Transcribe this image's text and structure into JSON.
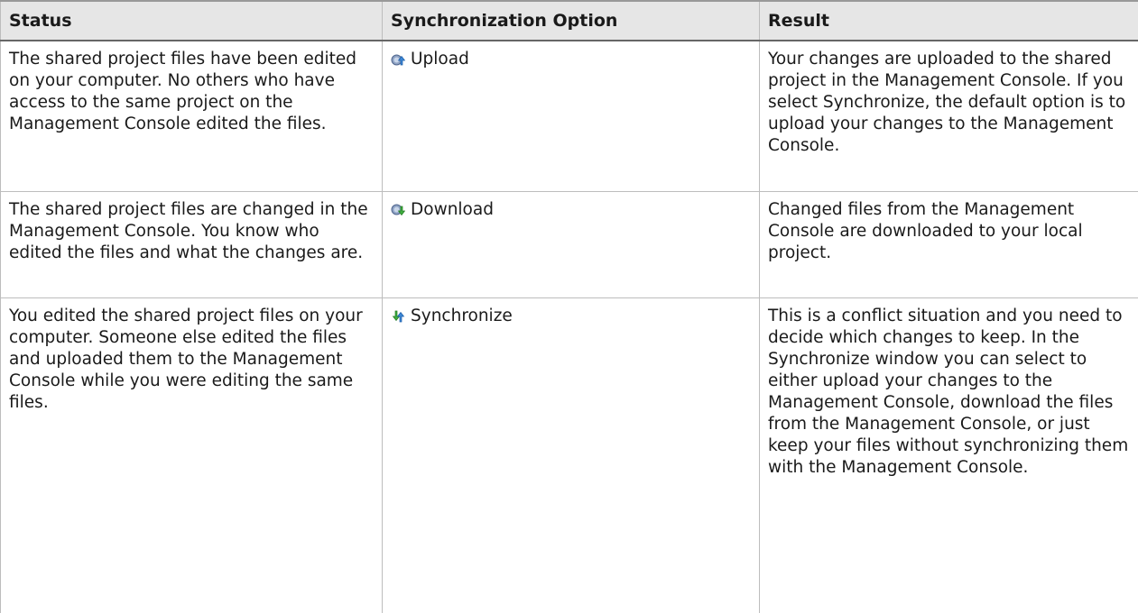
{
  "headers": {
    "status": "Status",
    "option": "Synchronization Option",
    "result": "Result"
  },
  "rows": [
    {
      "status": "The shared project files have been edited on your computer. No others who have access to the same project on the Management Console edited the files.",
      "option": "Upload",
      "option_icon": "upload-icon",
      "result": "Your changes are uploaded to the shared project in the Management Console. If you select Synchronize, the default option is to upload your changes to the Management Console."
    },
    {
      "status": "The shared project files are changed in the Management Console. You know who edited the files and what the changes are.",
      "option": "Download",
      "option_icon": "download-icon",
      "result": "Changed files from the Management Console are downloaded to your local project."
    },
    {
      "status": "You edited the shared project files on your computer. Someone else edited the files and uploaded them to the Management Console while you were editing the same files.",
      "option": "Synchronize",
      "option_icon": "synchronize-icon",
      "result": "This is a conflict situation and you need to decide which changes to keep. In the Synchronize window you can select to either upload your changes to the Management Console, download the files from the Management Console, or just keep your files without synchronizing them with the Management Console."
    }
  ]
}
